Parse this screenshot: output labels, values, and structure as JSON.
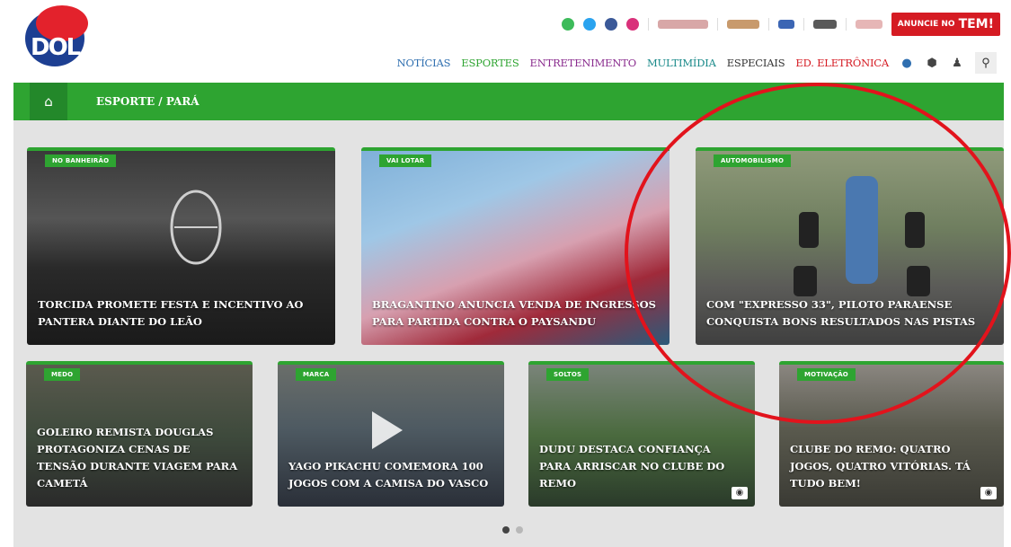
{
  "header": {
    "logo_text": "DOL",
    "social_icons": [
      "whatsapp-icon",
      "twitter-icon",
      "facebook-icon",
      "instagram-icon"
    ],
    "partner_logos": [
      "radio-icon",
      "tv-icon",
      "newspaper-icon",
      "brand-icon",
      "partner-icon"
    ],
    "advertise": {
      "label": "ANUNCIE NO",
      "brand": "TEM!"
    }
  },
  "nav": {
    "items": [
      {
        "label": "NOTÍCIAS",
        "color": "#2f6fb0"
      },
      {
        "label": "ESPORTES",
        "color": "#2ea431"
      },
      {
        "label": "ENTRETENIMENTO",
        "color": "#8a2c8e"
      },
      {
        "label": "MULTIMÍDIA",
        "color": "#1a8a8a"
      },
      {
        "label": "ESPECIAIS",
        "color": "#333333"
      },
      {
        "label": "ED. ELETRÔNICA",
        "color": "#d51b23"
      }
    ],
    "icons": [
      "shield-icon",
      "badge-icon",
      "user-icon",
      "search-icon"
    ]
  },
  "breadcrumb": {
    "home_icon": "home-icon",
    "path": "ESPORTE / PARÁ"
  },
  "featured": [
    {
      "tag": "NO BANHEIRÃO",
      "headline": "TORCIDA PROMETE FESTA E INCENTIVO AO PANTERA DIANTE DO LEÃO",
      "image": "stadium-crowd-image"
    },
    {
      "tag": "VAI LOTAR",
      "headline": "BRAGANTINO ANUNCIA VENDA DE INGRESSOS PARA PARTIDA CONTRA O PAYSANDU",
      "image": "smoke-flares-image"
    },
    {
      "tag": "AUTOMOBILISMO",
      "headline": "COM \"EXPRESSO 33\", PILOTO PARAENSE CONQUISTA BONS RESULTADOS NAS PISTAS",
      "image": "race-car-image"
    }
  ],
  "cards": [
    {
      "tag": "MEDO",
      "headline": "GOLEIRO REMISTA DOUGLAS PROTAGONIZA CENAS DE TENSÃO DURANTE VIAGEM PARA CAMETÁ",
      "icon": ""
    },
    {
      "tag": "MARCA",
      "headline": "YAGO PIKACHU COMEMORA 100 JOGOS COM A CAMISA DO VASCO",
      "icon": "play-icon"
    },
    {
      "tag": "SOLTOS",
      "headline": "DUDU DESTACA CONFIANÇA PARA ARRISCAR NO CLUBE DO REMO",
      "icon": "camera-icon"
    },
    {
      "tag": "MOTIVAÇÃO",
      "headline": "CLUBE DO REMO: QUATRO JOGOS, QUATRO VITÓRIAS. TÁ TUDO BEM!",
      "icon": "camera-icon"
    }
  ],
  "carousel": {
    "page_count": 2,
    "active_index": 0
  },
  "annotation": {
    "shape": "circle",
    "color": "#e2131c",
    "target": "featured-card-3"
  }
}
